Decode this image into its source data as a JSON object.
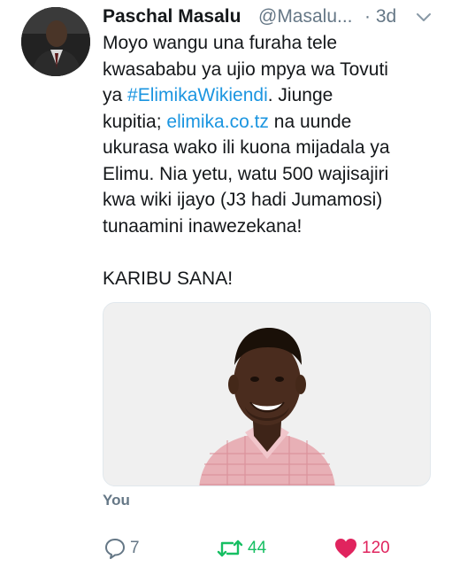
{
  "tweet": {
    "author_name": "Paschal Masalu",
    "author_handle": "@Masalu...",
    "timestamp": "· 3d",
    "text_lines": [
      "Moyo wangu una furaha tele",
      "kwasababu ya ujio mpya wa Tovuti",
      "Jiunge",
      "kupitia;",
      "na uunde",
      "ukurasa wako ili kuona mijadala ya",
      "Elimu. Nia yetu, watu 500 wajisajiri",
      "kwa wiki ijayo (J3 hadi Jumamosi)",
      "tunaamini inawezekana!",
      "KARIBU SANA!"
    ],
    "line3_prefix": "ya",
    "hashtag": "#ElimikaWikiendi",
    "hashtag_suffix": ". ",
    "link": "elimika.co.tz",
    "tagged_label": "You"
  },
  "actions": {
    "reply_count": "7",
    "retweet_count": "44",
    "like_count": "120"
  },
  "icons": {
    "menu": "chevron-down-icon",
    "reply": "reply-icon",
    "retweet": "retweet-icon",
    "like": "heart-icon"
  },
  "colors": {
    "link": "#1b95e0",
    "muted": "#657786",
    "retweet": "#17bf63",
    "like": "#e0245e",
    "text": "#14171a"
  }
}
